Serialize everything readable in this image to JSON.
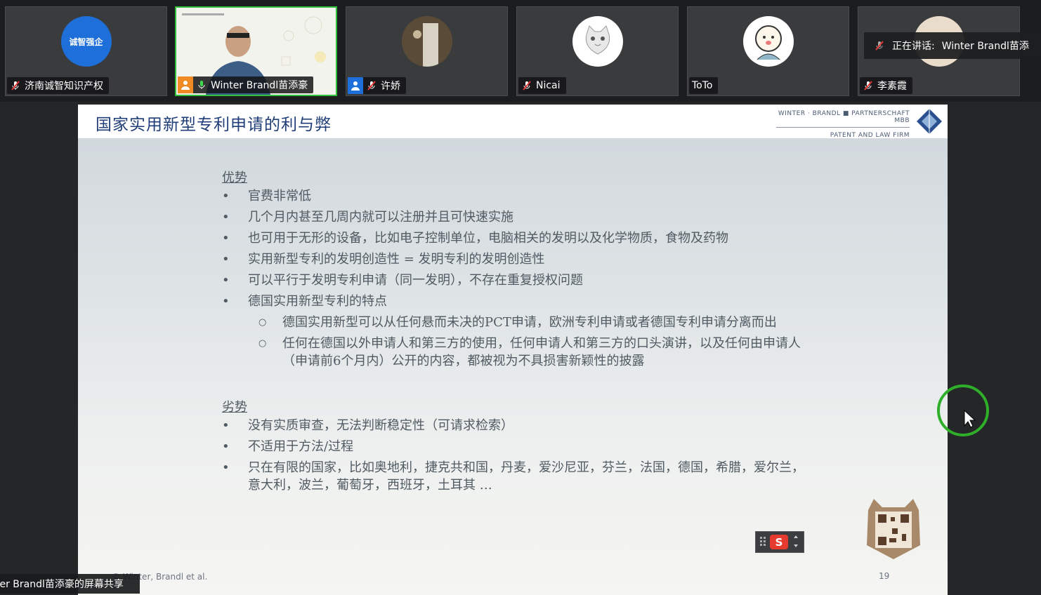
{
  "participants": [
    {
      "name": "济南诚智知识产权",
      "logo_text": "诚智强企",
      "mic": "muted"
    },
    {
      "name": "Winter Brandl苗添豪",
      "mic": "active",
      "host": true
    },
    {
      "name": "许娇",
      "mic": "muted",
      "host": true
    },
    {
      "name": "Nicai",
      "mic": "muted"
    },
    {
      "name": "ToTo"
    },
    {
      "name": "李素霞",
      "mic": "muted"
    }
  ],
  "speaking": {
    "label": "正在讲话:",
    "name": "Winter Brandl苗添"
  },
  "slide": {
    "title": "国家实用新型专利申请的利与弊",
    "firm_line1": "WINTER · BRANDL ■ PARTNERSCHAFT MBB",
    "firm_line2": "PATENT AND LAW FIRM",
    "advantages_heading": "优势",
    "advantages": [
      "官费非常低",
      "几个月内甚至几周内就可以注册并且可快速实施",
      "也可用于无形的设备，比如电子控制单位，电脑相关的发明以及化学物质，食物及药物",
      "实用新型专利的发明创造性 = 发明专利的发明创造性",
      "可以平行于发明专利申请（同一发明），不存在重复授权问题",
      "德国实用新型专利的特点"
    ],
    "sub_points": [
      "德国实用新型可以从任何悬而未决的PCT申请，欧洲专利申请或者德国专利申请分离而出",
      "任何在德国以外申请人和第三方的使用，任何申请人和第三方的口头演讲，以及任何由申请人（申请前6个月内）公开的内容，都被视为不具损害新颖性的披露"
    ],
    "disadvantages_heading": "劣势",
    "disadvantages": [
      "没有实质审查，无法判断稳定性（可请求检索）",
      "不适用于方法/过程",
      "只在有限的国家，比如奥地利，捷克共和国，丹麦，爱沙尼亚，芬兰，法国，德国，希腊，爱尔兰，意大利，波兰，葡萄牙，西班牙，土耳其 …"
    ],
    "footer": "© Winter, Brandl et al.",
    "page_number": "19"
  },
  "share_label": "ter Brandl苗添豪的屏幕共享",
  "colors": {
    "active_border": "#2fbf3a",
    "title": "#1f3d78",
    "brand_blue": "#1e6fd9"
  }
}
